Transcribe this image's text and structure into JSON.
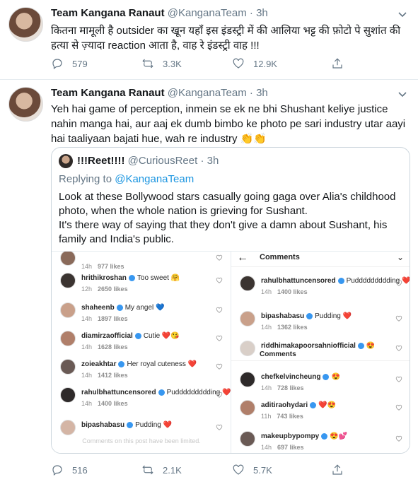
{
  "colors": {
    "accent": "#1b95e0",
    "secondary_text": "#657786",
    "border": "#e6ecf0"
  },
  "tweets": [
    {
      "name": "Team Kangana Ranaut",
      "handle": "@KanganaTeam",
      "sep": "·",
      "time": "3h",
      "text": "कितना मामूली है outsider का खून यहाँ इस इंडस्ट्री में की आलिया भट्ट की फ़ोटो पे सुशांत की हत्या से ज़्यादा reaction आता है, वाह रे इंडस्ट्री वाह !!!",
      "replies": "579",
      "retweets": "3.3K",
      "likes": "12.9K"
    },
    {
      "name": "Team Kangana Ranaut",
      "handle": "@KanganaTeam",
      "sep": "·",
      "time": "3h",
      "text": "Yeh hai game of perception, inmein se ek ne bhi Shushant keliye justice nahin manga hai, aur aaj ek dumb bimbo ke photo pe sari industry utar aayi hai taaliyaan bajati hue, wah re industry 👏👏",
      "replies": "516",
      "retweets": "2.1K",
      "likes": "5.7K"
    }
  ],
  "quote": {
    "name": "!!!Reet!!!!",
    "handle": "@CuriousReet",
    "sep": "·",
    "time": "3h",
    "replying_prefix": "Replying to ",
    "replying_to": "@KanganaTeam",
    "text_1": "Look at these Bollywood stars casually going gaga over Alia's childhood photo, when the whole nation is grieving for Sushant.",
    "text_2": "It's there way of saying that they don't give a damn about Sushant, his family and India's public.",
    "left_comments": [
      {
        "user": "",
        "comment": "",
        "time": "14h",
        "likes": "977 likes"
      },
      {
        "user": "hrithikroshan",
        "comment": "Too sweet 🤗",
        "time": "12h",
        "likes": "2650 likes"
      },
      {
        "user": "shaheenb",
        "comment": "My angel 💙",
        "time": "14h",
        "likes": "1897 likes"
      },
      {
        "user": "diamirzaofficial",
        "comment": "Cutie ❤️😘",
        "time": "14h",
        "likes": "1628 likes"
      },
      {
        "user": "zoieakhtar",
        "comment": "Her royal cuteness ❤️",
        "time": "14h",
        "likes": "1412 likes"
      },
      {
        "user": "rahulbhattuncensored",
        "comment": "Puddddddddding ❤️❤️❤️❤️",
        "time": "14h",
        "likes": "1400 likes"
      },
      {
        "user": "bipashabasu",
        "comment": "Pudding ❤️",
        "time": "",
        "likes": ""
      }
    ],
    "limited": "Comments on this post have been limited.",
    "right_header": "Comments",
    "right_header_2": "Comments",
    "right_comments": [
      {
        "user": "rahulbhattuncensored",
        "comment": "Puddddddddding ❤️❤️❤️❤️",
        "time": "14h",
        "likes": "1400 likes"
      },
      {
        "user": "bipashabasu",
        "comment": "Pudding ❤️",
        "time": "14h",
        "likes": "1362 likes"
      },
      {
        "user": "riddhimakapoorsahniofficial",
        "comment": "😍",
        "time": "",
        "likes": ""
      },
      {
        "user": "chefkelvincheung",
        "comment": "😍",
        "time": "14h",
        "likes": "728 likes"
      },
      {
        "user": "aditiraohydari",
        "comment": "❤️😍",
        "time": "11h",
        "likes": "743 likes"
      },
      {
        "user": "makeupbypompy",
        "comment": "😍💕",
        "time": "14h",
        "likes": "697 likes"
      }
    ]
  }
}
